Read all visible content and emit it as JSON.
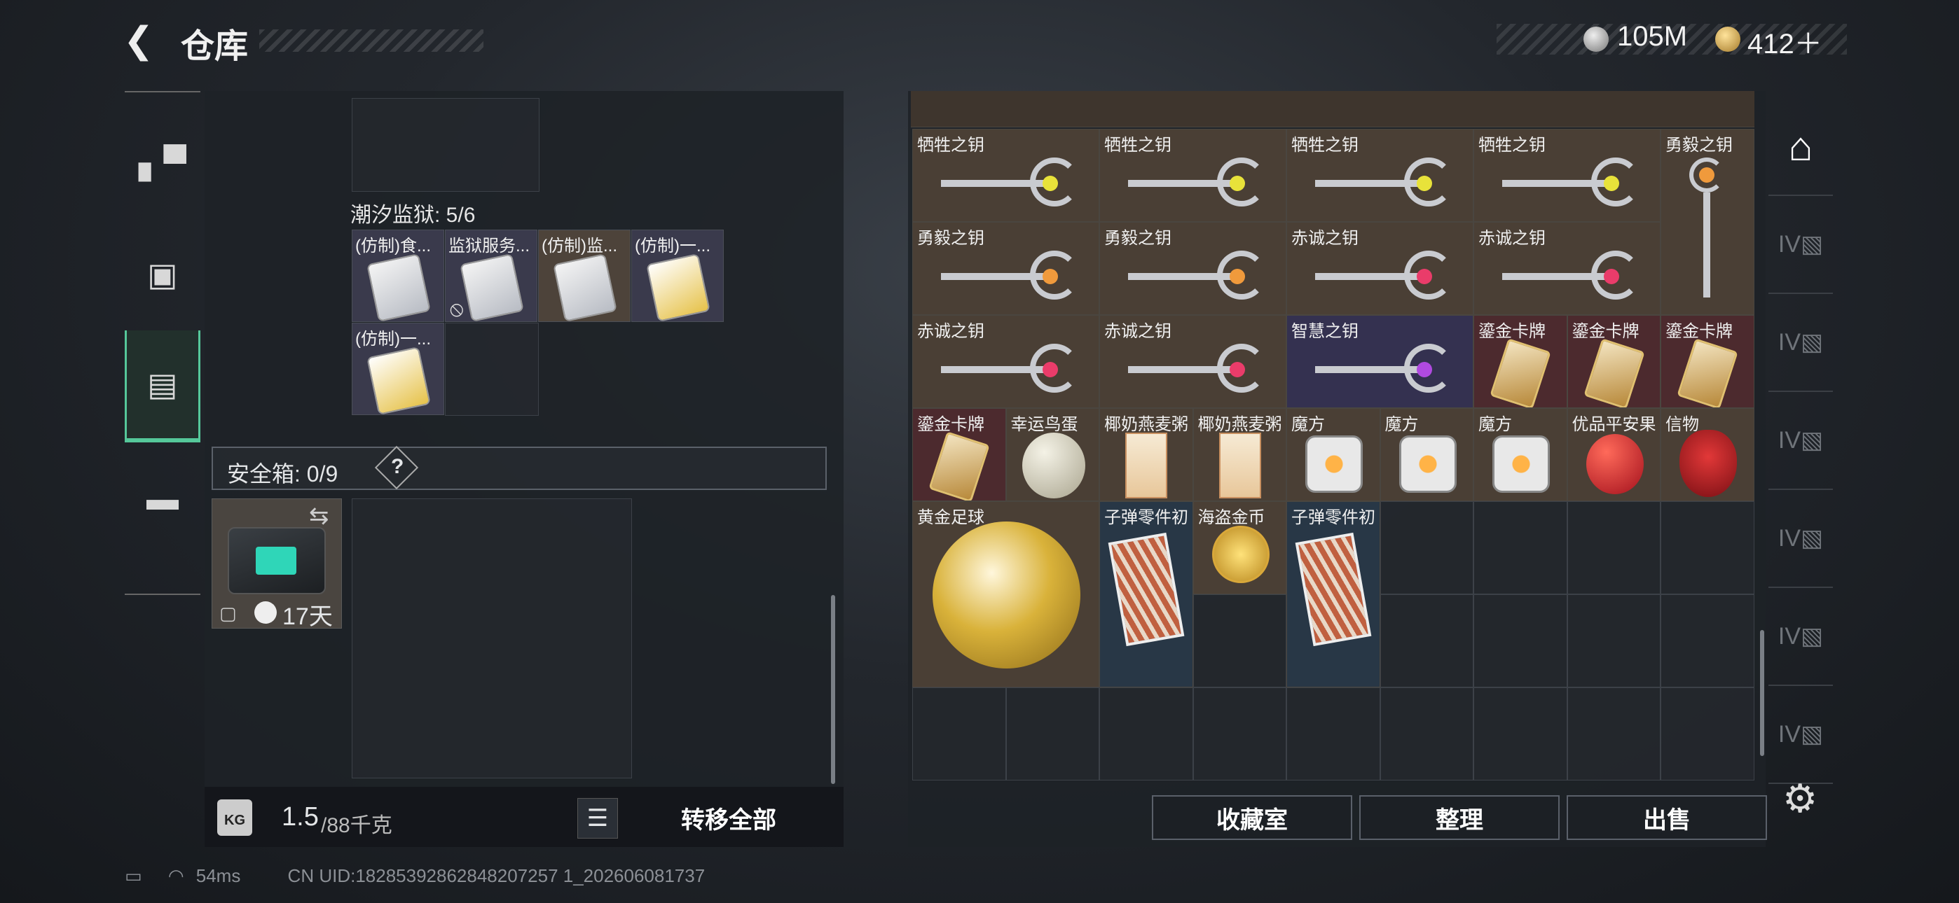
{
  "header": {
    "title": "仓库",
    "back_icon": "back-arrow-icon"
  },
  "currency": {
    "silver": "105M",
    "gold": "412＋"
  },
  "left_nav": [
    {
      "icon": "pistol-icon"
    },
    {
      "icon": "backpack-icon"
    },
    {
      "icon": "storage-icon",
      "active": true
    },
    {
      "icon": "briefcase-icon"
    }
  ],
  "left_panel": {
    "section_label": "潮汐监狱: 5/6",
    "section_items": [
      {
        "name": "(仿制)食..."
      },
      {
        "name": "监狱服务..."
      },
      {
        "name": "(仿制)监..."
      },
      {
        "name": "(仿制)一..."
      },
      {
        "name": "(仿制)一..."
      }
    ],
    "safebox_label": "安全箱: 0/9",
    "safebox_help": "?",
    "safebox_timer": "17天",
    "weight_value": "1.5",
    "weight_max": "/88千克",
    "transfer_all": "转移全部"
  },
  "right_panel": {
    "items": [
      {
        "name": "牺牲之钥",
        "kind": "key",
        "gem": "#e8e23a",
        "bg": "brown"
      },
      {
        "name": "牺牲之钥",
        "kind": "key",
        "gem": "#e8e23a",
        "bg": "brown"
      },
      {
        "name": "牺牲之钥",
        "kind": "key",
        "gem": "#e8e23a",
        "bg": "brown"
      },
      {
        "name": "牺牲之钥",
        "kind": "key",
        "gem": "#e8e23a",
        "bg": "brown"
      },
      {
        "name": "勇毅之钥",
        "kind": "key-vertical",
        "gem": "#f09a3c",
        "bg": "brown"
      },
      {
        "name": "勇毅之钥",
        "kind": "key",
        "gem": "#f09a3c",
        "bg": "brown"
      },
      {
        "name": "勇毅之钥",
        "kind": "key",
        "gem": "#f09a3c",
        "bg": "brown"
      },
      {
        "name": "赤诚之钥",
        "kind": "key",
        "gem": "#ea3c6a",
        "bg": "brown"
      },
      {
        "name": "赤诚之钥",
        "kind": "key",
        "gem": "#ea3c6a",
        "bg": "brown"
      },
      {
        "name": "赤诚之钥",
        "kind": "key",
        "gem": "#ea3c6a",
        "bg": "brown"
      },
      {
        "name": "赤诚之钥",
        "kind": "key",
        "gem": "#ea3c6a",
        "bg": "brown"
      },
      {
        "name": "智慧之钥",
        "kind": "key",
        "gem": "#b04ae0",
        "bg": "purple"
      },
      {
        "name": "鎏金卡牌",
        "kind": "card",
        "bg": "red"
      },
      {
        "name": "鎏金卡牌",
        "kind": "card",
        "bg": "red"
      },
      {
        "name": "鎏金卡牌",
        "kind": "card",
        "bg": "red"
      },
      {
        "name": "鎏金卡牌",
        "kind": "card",
        "bg": "red"
      },
      {
        "name": "幸运鸟蛋",
        "kind": "egg",
        "bg": "brown"
      },
      {
        "name": "椰奶燕麦粥",
        "kind": "box",
        "bg": "brown"
      },
      {
        "name": "椰奶燕麦粥",
        "kind": "box",
        "bg": "brown"
      },
      {
        "name": "魔方",
        "kind": "cube",
        "bg": "brown"
      },
      {
        "name": "魔方",
        "kind": "cube",
        "bg": "brown"
      },
      {
        "name": "魔方",
        "kind": "cube",
        "bg": "brown"
      },
      {
        "name": "优品平安果",
        "kind": "apple",
        "bg": "brown"
      },
      {
        "name": "信物",
        "kind": "mask",
        "bg": "brown"
      },
      {
        "name": "黄金足球",
        "kind": "ball",
        "bg": "brown"
      },
      {
        "name": "子弹零件初",
        "kind": "ammo",
        "bg": "blue"
      },
      {
        "name": "海盗金币",
        "kind": "coin",
        "bg": "brown"
      },
      {
        "name": "子弹零件初",
        "kind": "ammo",
        "bg": "blue"
      }
    ],
    "buttons": {
      "collection": "收藏室",
      "sort": "整理",
      "sell": "出售"
    }
  },
  "right_tabs": [
    {
      "icon": "vault-icon",
      "active": true
    },
    {
      "icon": "tier-iv-gun-icon"
    },
    {
      "icon": "tier-iv-gun-icon"
    },
    {
      "icon": "tier-iv-gun-icon"
    },
    {
      "icon": "tier-iv-gun-icon"
    },
    {
      "icon": "tier-iv-gun-icon"
    },
    {
      "icon": "tier-iv-gun-icon"
    }
  ],
  "status": {
    "ping": "54ms",
    "uid": "CN UID:18285392862848207257 1_202606081737"
  },
  "colors": {
    "accent": "#55c89a"
  }
}
